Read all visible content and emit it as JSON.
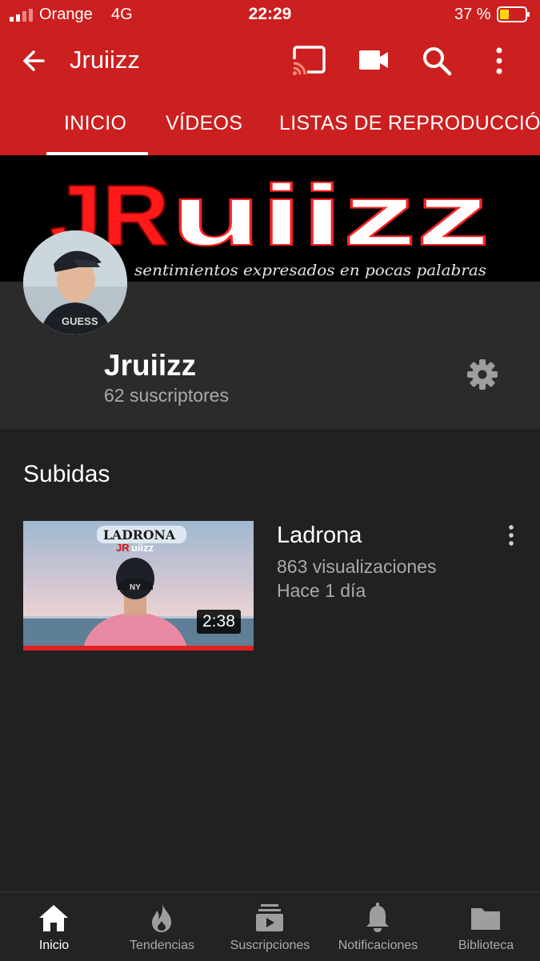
{
  "status_bar": {
    "carrier": "Orange",
    "network": "4G",
    "time": "22:29",
    "battery": "37 %"
  },
  "app_bar": {
    "title": "Jruiizz",
    "icons": [
      "back-arrow-icon",
      "cast-icon",
      "video-camera-icon",
      "search-icon",
      "more-vert-icon"
    ]
  },
  "tabs": [
    {
      "label": "INICIO",
      "active": true
    },
    {
      "label": "VÍDEOS",
      "active": false
    },
    {
      "label": "LISTAS DE REPRODUCCIÓ",
      "active": false
    }
  ],
  "banner": {
    "logo_red": "JR",
    "logo_white": "uiizz",
    "tagline": "sentimientos expresados en pocas palabras"
  },
  "channel": {
    "name": "Jruiizz",
    "subscribers": "62 suscriptores"
  },
  "uploads": {
    "title": "Subidas",
    "videos": [
      {
        "title": "Ladrona",
        "views": "863 visualizaciones",
        "age": "Hace 1 día",
        "duration": "2:38",
        "thumb_title": "LADRONA",
        "thumb_logo_red": "JR",
        "thumb_logo_white": "uiizz",
        "watched_fraction": 1.0
      }
    ]
  },
  "bottom_nav": [
    {
      "label": "Inicio",
      "icon": "home-icon",
      "active": true
    },
    {
      "label": "Tendencias",
      "icon": "flame-icon",
      "active": false
    },
    {
      "label": "Suscripciones",
      "icon": "subscriptions-icon",
      "active": false
    },
    {
      "label": "Notificaciones",
      "icon": "bell-icon",
      "active": false
    },
    {
      "label": "Biblioteca",
      "icon": "folder-icon",
      "active": false
    }
  ],
  "colors": {
    "brand_red": "#cc1f1f",
    "background": "#212121",
    "header_bg": "#2b2b2b",
    "secondary_text": "#aaaaaa"
  }
}
